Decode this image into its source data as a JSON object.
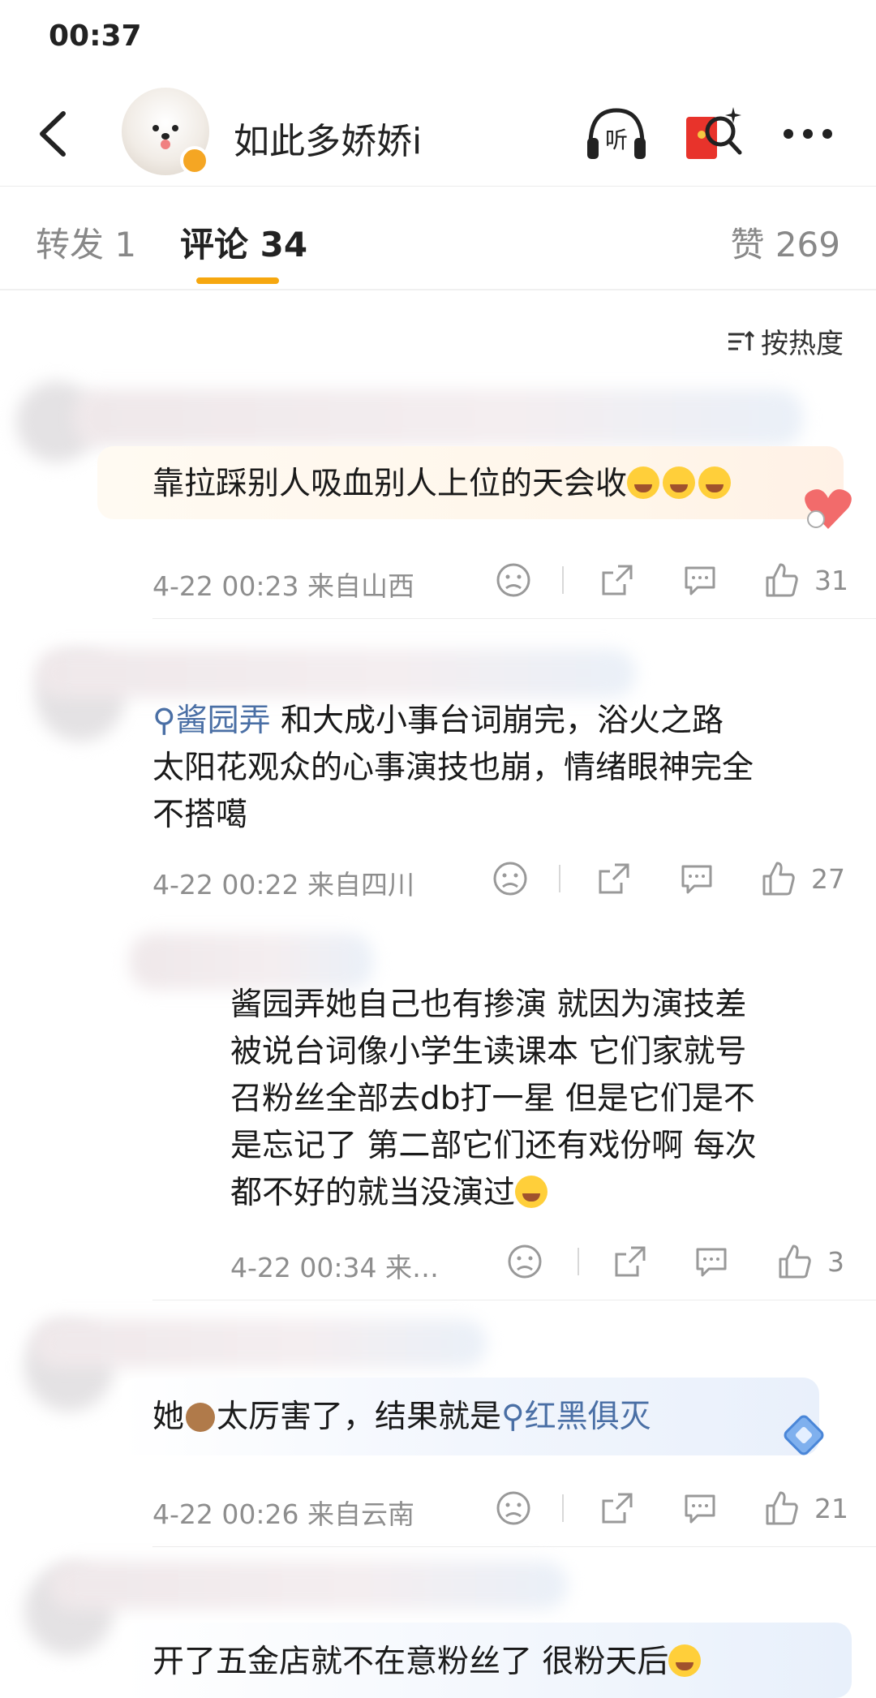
{
  "status_bar": {
    "time": "00:37"
  },
  "header": {
    "title": "如此多娇娇i"
  },
  "tabs": {
    "repost": "转发 1",
    "comment": "评论 34",
    "like": "赞 269"
  },
  "sort": {
    "label": "按热度"
  },
  "comments": [
    {
      "text": "靠拉踩别人吸血别人上位的天会收",
      "time": "4-22 00:23",
      "location": "来自山西",
      "likes": "31"
    },
    {
      "mention": "酱园弄",
      "text_line1": "和大成小事台词崩完，浴火之路",
      "text_line2": "太阳花观众的心事演技也崩，情绪眼神完全",
      "text_line3": "不搭噶",
      "time": "4-22 00:22",
      "location": "来自四川",
      "likes": "27"
    },
    {
      "line1": "酱园弄她自己也有掺演 就因为演技差",
      "line2": "被说台词像小学生读课本 它们家就号",
      "line3": "召粉丝全部去db打一星 但是它们是不",
      "line4": "是忘记了 第二部它们还有戏份啊 每次",
      "line5": "都不好的就当没演过",
      "time": "4-22 00:34",
      "location": "来…",
      "likes": "3"
    },
    {
      "text_a": "她",
      "text_b": "太厉害了，结果就是",
      "mention": "红黑俱灭",
      "time": "4-22 00:26",
      "location": "来自云南",
      "likes": "21"
    },
    {
      "text": "开了五金店就不在意粉丝了 很粉天后"
    }
  ]
}
